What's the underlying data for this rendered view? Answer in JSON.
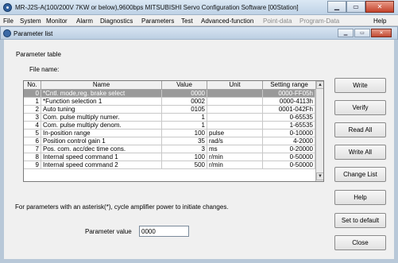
{
  "titlebar": {
    "title": "MR-J2S-A(100/200V 7KW or below),9600bps     MITSUBISHI Servo Configuration Software   [00Station]"
  },
  "menu": {
    "file": "File",
    "system": "System",
    "monitor": "Monitor",
    "alarm": "Alarm",
    "diagnostics": "Diagnostics",
    "parameters": "Parameters",
    "test": "Test",
    "advanced": "Advanced-function",
    "point_data": "Point-data",
    "program_data": "Program-Data",
    "help": "Help"
  },
  "window": {
    "title": "Parameter list"
  },
  "content": {
    "section_label": "Parameter table",
    "file_name_label": "File name:",
    "note": "For parameters with an asterisk(*), cycle amplifier power to initiate changes.",
    "param_value_label": "Parameter value",
    "param_value": "0000"
  },
  "table": {
    "headers": {
      "no": "No.",
      "name": "Name",
      "value": "Value",
      "unit": "Unit",
      "range": "Setting range"
    },
    "rows": [
      {
        "no": "0",
        "name": "*Cntl. mode,reg. brake select",
        "value": "0000",
        "unit": "",
        "range": "0000-FF05h"
      },
      {
        "no": "1",
        "name": "*Function selection 1",
        "value": "0002",
        "unit": "",
        "range": "0000-4113h"
      },
      {
        "no": "2",
        "name": "Auto tuning",
        "value": "0105",
        "unit": "",
        "range": "0001-042Fh"
      },
      {
        "no": "3",
        "name": "Com. pulse multiply numer.",
        "value": "1",
        "unit": "",
        "range": "0-65535"
      },
      {
        "no": "4",
        "name": "Com. pulse multiply denom.",
        "value": "1",
        "unit": "",
        "range": "1-65535"
      },
      {
        "no": "5",
        "name": "In-position range",
        "value": "100",
        "unit": "pulse",
        "range": "0-10000"
      },
      {
        "no": "6",
        "name": "Position control gain 1",
        "value": "35",
        "unit": "rad/s",
        "range": "4-2000"
      },
      {
        "no": "7",
        "name": "Pos. com. acc/dec time cons.",
        "value": "3",
        "unit": "ms",
        "range": "0-20000"
      },
      {
        "no": "8",
        "name": "Internal speed command 1",
        "value": "100",
        "unit": "r/min",
        "range": "0-50000"
      },
      {
        "no": "9",
        "name": "Internal speed command 2",
        "value": "500",
        "unit": "r/min",
        "range": "0-50000"
      }
    ]
  },
  "buttons": {
    "write": "Write",
    "verify": "Verify",
    "read_all": "Read All",
    "write_all": "Write All",
    "change_list": "Change List",
    "help": "Help",
    "set_default": "Set to default",
    "close": "Close"
  }
}
